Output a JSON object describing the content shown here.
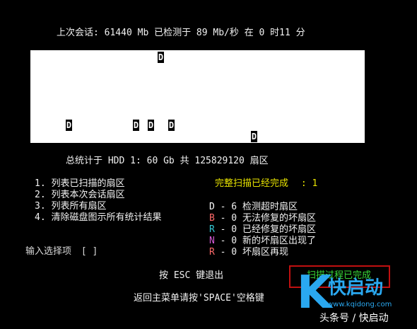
{
  "session": {
    "text": "上次会话:   61440 Mb  已检测于  89 Mb/秒  在 0 时11 分"
  },
  "scan_map": {
    "marks": [
      {
        "label": "D"
      },
      {
        "label": "D"
      },
      {
        "label": "D"
      },
      {
        "label": "D"
      },
      {
        "label": "D"
      },
      {
        "label": "D"
      }
    ]
  },
  "totals": {
    "text": "总统计于 HDD 1: 60 Gb 共 125829120 扇区"
  },
  "menu": {
    "items": [
      {
        "label": "1. 列表已扫描的扇区"
      },
      {
        "label": "2. 列表本次会话扇区"
      },
      {
        "label": "3. 列表所有扇区"
      },
      {
        "label": "4. 清除磁盘图示所有统计结果"
      }
    ]
  },
  "status": {
    "full_scan_label": "完整扫描已经完成",
    "full_scan_value": ": 1"
  },
  "legend": {
    "rows": [
      {
        "key": "D",
        "text": " - 6 检测超时扇区"
      },
      {
        "key": "B",
        "text": " - 0 无法修复的坏扇区"
      },
      {
        "key": "R",
        "text": " - 0 已经修复的坏扇区"
      },
      {
        "key": "N",
        "text": " - 0 新的坏扇区出现了"
      },
      {
        "key": "R",
        "text": " - 0 坏扇区再现"
      }
    ]
  },
  "prompt": {
    "label": "输入选择项",
    "cursor": "[ ]"
  },
  "footer": {
    "esc_hint": "按 ESC 键退出",
    "space_hint": "返回主菜单请按'SPACE'空格键"
  },
  "done": {
    "text": "扫描过程已完成"
  },
  "watermark": {
    "brand": "快启动",
    "url": "www.kqidong.com",
    "bottom": "头条号 / 快启动",
    "logo_letter": "K"
  },
  "colors": {
    "background": "#000000",
    "map_background": "#ffffff",
    "complete_yellow": "#e8e300",
    "done_green": "#38d838",
    "done_border_red": "#c01010",
    "legend_b": "#ff6a6a",
    "legend_r": "#35c7d4",
    "legend_n": "#d65bd6",
    "watermark_blue": "#2aa8f0"
  }
}
